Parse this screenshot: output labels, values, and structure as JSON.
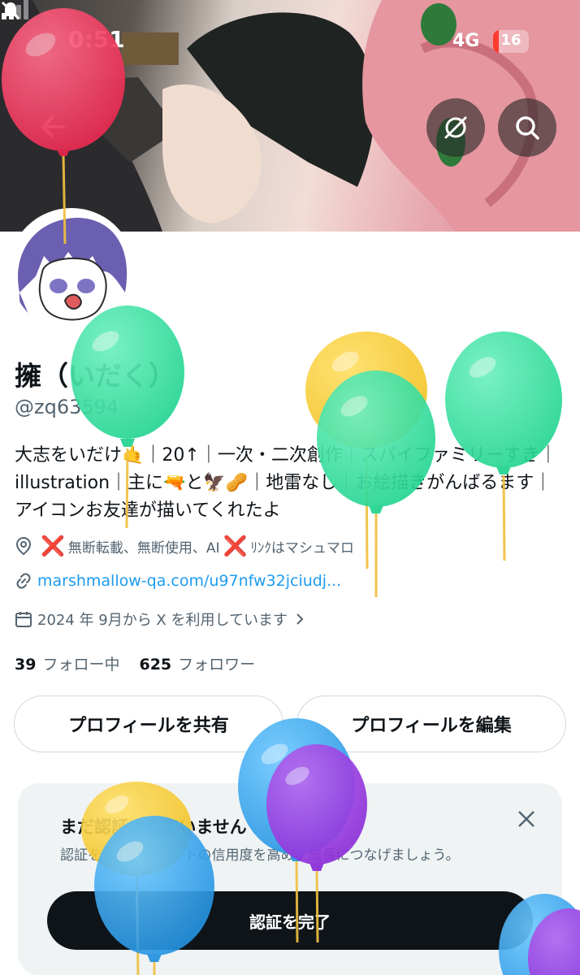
{
  "status_bar": {
    "time": "0:51",
    "network": "4G",
    "battery": "16",
    "battery_level": 0.16
  },
  "header": {
    "back_icon": "arrow-left-icon",
    "hide_icon": "eye-slash-icon",
    "search_icon": "search-icon"
  },
  "profile": {
    "display_name": "擁（いだく）",
    "handle": "@zq63594",
    "bio": "大志をいだけ🤙｜20↑｜一次・二次創作｜スパイファミリーすき｜illustration｜主に🔫と🦅🥜｜地雷なし｜お絵描きがんばるます｜アイコンお友達が描いてくれたよ",
    "location_before": "無断転載、無断使用、AI",
    "location_after": "ﾘﾝｸはマシュマロ",
    "location_mark": "❌",
    "link": "marshmallow-qa.com/u97nfw32jciudj...",
    "joined": "2024 年 9月から X を利用しています",
    "following_count": "39",
    "following_label": "フォロー中",
    "followers_count": "625",
    "followers_label": "フォロワー"
  },
  "actions": {
    "share_label": "プロフィールを共有",
    "edit_label": "プロフィールを編集"
  },
  "verify": {
    "title": "まだ認証されていません",
    "description": "認証をしてアカウントの信用度を高め、成長につなげましょう。",
    "button_label": "認証を完了"
  },
  "colors": {
    "accent": "#1d9bf0",
    "text_primary": "#0f1419",
    "text_secondary": "#536471",
    "danger": "#e0241f"
  }
}
